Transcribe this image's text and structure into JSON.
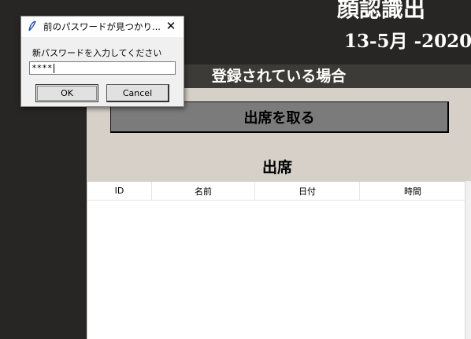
{
  "app": {
    "title_fragment": "顔認識出",
    "date": "13-5月 -2020",
    "registered_label": "登録されている場合",
    "take_attendance_button": "出席を取る",
    "attendance_heading": "出席",
    "table": {
      "columns": [
        "ID",
        "名前",
        "日付",
        "時間"
      ]
    }
  },
  "dialog": {
    "icon": "feather-icon",
    "title": "前のパスワードが見つかり...",
    "close_glyph": "✕",
    "prompt": "新パスワードを入力してください",
    "input_value": "****",
    "ok_label": "OK",
    "cancel_label": "Cancel"
  },
  "colors": {
    "background": "#282624",
    "panel": "#d6d0c9",
    "button": "#7b7b7b",
    "dialog": "#f0f0f0"
  }
}
